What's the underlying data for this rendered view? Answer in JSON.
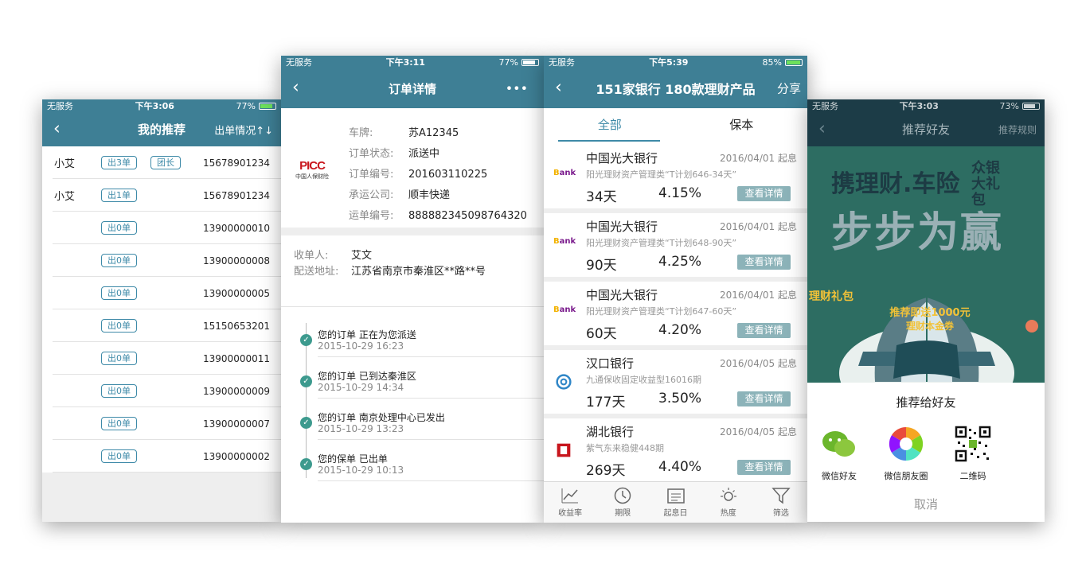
{
  "screen1": {
    "status": {
      "carrier": "无服务",
      "time": "下午3:06",
      "battery": "77%"
    },
    "title": "我的推荐",
    "action": "出单情况↑↓",
    "rows": [
      {
        "name": "小艾",
        "count": "出3单",
        "role": "团长",
        "phone": "15678901234"
      },
      {
        "name": "小艾",
        "count": "出1单",
        "role": "",
        "phone": "15678901234"
      },
      {
        "name": "",
        "count": "出0单",
        "role": "",
        "phone": "13900000010"
      },
      {
        "name": "",
        "count": "出0单",
        "role": "",
        "phone": "13900000008"
      },
      {
        "name": "",
        "count": "出0单",
        "role": "",
        "phone": "13900000005"
      },
      {
        "name": "",
        "count": "出0单",
        "role": "",
        "phone": "15150653201"
      },
      {
        "name": "",
        "count": "出0单",
        "role": "",
        "phone": "13900000011"
      },
      {
        "name": "",
        "count": "出0单",
        "role": "",
        "phone": "13900000009"
      },
      {
        "name": "",
        "count": "出0单",
        "role": "",
        "phone": "13900000007"
      },
      {
        "name": "",
        "count": "出0单",
        "role": "",
        "phone": "13900000002"
      }
    ]
  },
  "screen2": {
    "status": {
      "carrier": "无服务",
      "time": "下午3:11",
      "battery": "77%"
    },
    "title": "订单详情",
    "more": "•••",
    "logo": {
      "brand": "PICC",
      "sub": "中国人保财险"
    },
    "info": [
      {
        "k": "车牌:",
        "v": "苏A12345"
      },
      {
        "k": "订单状态:",
        "v": "派送中"
      },
      {
        "k": "订单编号:",
        "v": "201603110225"
      },
      {
        "k": "承运公司:",
        "v": "顺丰快递"
      },
      {
        "k": "运单编号:",
        "v": "888882345098764320"
      }
    ],
    "receiver": {
      "k": "收单人:",
      "v": "艾文"
    },
    "address": {
      "k": "配送地址:",
      "v": "江苏省南京市秦淮区**路**号"
    },
    "timeline": [
      {
        "text": "您的订单 正在为您派送",
        "time": "2015-10-29 16:23"
      },
      {
        "text": "您的订单 已到达秦淮区",
        "time": "2015-10-29 14:34"
      },
      {
        "text": "您的订单 南京处理中心已发出",
        "time": "2015-10-29 13:23"
      },
      {
        "text": "您的保单 已出单",
        "time": "2015-10-29 10:13"
      }
    ]
  },
  "screen3": {
    "status": {
      "carrier": "无服务",
      "time": "下午5:39",
      "battery": "85%"
    },
    "title": "151家银行 180款理财产品",
    "action": "分享",
    "tabs": [
      "全部",
      "保本"
    ],
    "products": [
      {
        "bank": "中国光大银行",
        "date": "2016/04/01 起息",
        "desc": "阳光理财资产管理类“T计划646-34天”",
        "days": "34天",
        "rate": "4.15%",
        "btn": "查看详情",
        "logo": "Bank"
      },
      {
        "bank": "中国光大银行",
        "date": "2016/04/01 起息",
        "desc": "阳光理财资产管理类“T计划648-90天”",
        "days": "90天",
        "rate": "4.25%",
        "btn": "查看详情",
        "logo": "Bank"
      },
      {
        "bank": "中国光大银行",
        "date": "2016/04/01 起息",
        "desc": "阳光理财资产管理类“T计划647-60天”",
        "days": "60天",
        "rate": "4.20%",
        "btn": "查看详情",
        "logo": "Bank"
      },
      {
        "bank": "汉口银行",
        "date": "2016/04/05 起息",
        "desc": "九通保收固定收益型16016期",
        "days": "177天",
        "rate": "3.50%",
        "btn": "查看详情",
        "logo": ""
      },
      {
        "bank": "湖北银行",
        "date": "2016/04/05 起息",
        "desc": "紫气东来稳健448期",
        "days": "269天",
        "rate": "4.40%",
        "btn": "查看详情",
        "logo": ""
      }
    ],
    "tabbar": [
      "收益率",
      "期限",
      "起息日",
      "热度",
      "筛选"
    ]
  },
  "screen4": {
    "status": {
      "carrier": "无服务",
      "time": "下午3:03",
      "battery": "73%"
    },
    "title": "推荐好友",
    "action": "推荐规则",
    "banner": {
      "line1": "携理财.车险",
      "badge": "众银大礼包",
      "line2": "步步为赢",
      "gift": "理财礼包",
      "ribbon1": "推荐即送1000元",
      "ribbon2": "理财本金券"
    },
    "share_title": "推荐给好友",
    "share": [
      "微信好友",
      "微信朋友圈",
      "二维码"
    ],
    "cancel": "取消"
  },
  "colors": {
    "header": "#3e7f95",
    "accent": "#3e8aa8",
    "button": "#8cb3b9",
    "timeline": "#3d9a8e"
  }
}
